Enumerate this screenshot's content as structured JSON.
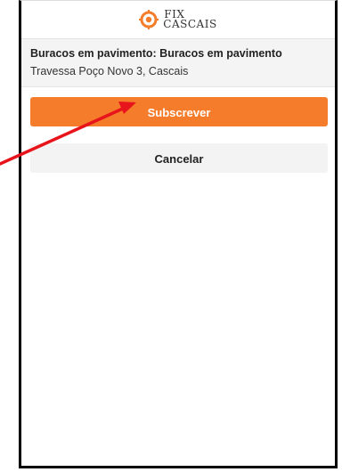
{
  "header": {
    "logo_line1": "FIX",
    "logo_line2": "CASCAIS",
    "logo_icon": "target-crosshair-icon",
    "accent_color": "#f47c2a"
  },
  "report": {
    "title": "Buracos em pavimento: Buracos em pavimento",
    "address": "Travessa Poço Novo 3, Cascais"
  },
  "actions": {
    "subscribe_label": "Subscrever",
    "cancel_label": "Cancelar"
  },
  "annotation": {
    "icon": "red-arrow-pointer",
    "color": "#e8141b"
  }
}
